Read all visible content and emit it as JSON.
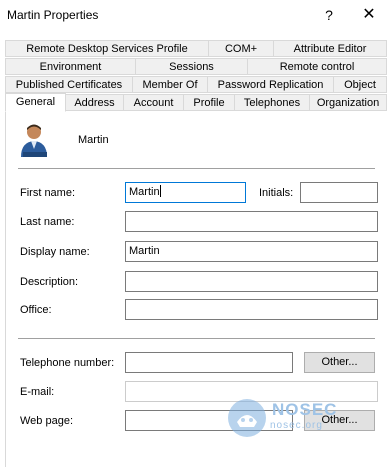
{
  "window": {
    "title": "Martin Properties",
    "help_glyph": "?",
    "close_glyph": "✕"
  },
  "tabs": {
    "row1": [
      "Remote Desktop Services Profile",
      "COM+",
      "Attribute Editor"
    ],
    "row2": [
      "Environment",
      "Sessions",
      "Remote control"
    ],
    "row3": [
      "Published Certificates",
      "Member Of",
      "Password Replication",
      "Object"
    ],
    "row4": [
      "General",
      "Address",
      "Account",
      "Profile",
      "Telephones",
      "Organization"
    ],
    "active": "General"
  },
  "general": {
    "user_display": "Martin",
    "first_name_label": "First name:",
    "first_name_value": "Martin",
    "initials_label": "Initials:",
    "initials_value": "",
    "last_name_label": "Last name:",
    "last_name_value": "",
    "display_name_label": "Display name:",
    "display_name_value": "Martin",
    "description_label": "Description:",
    "description_value": "",
    "office_label": "Office:",
    "office_value": "",
    "telephone_label": "Telephone number:",
    "telephone_value": "",
    "telephone_other_button": "Other...",
    "email_label": "E-mail:",
    "email_value": "",
    "webpage_label": "Web page:",
    "webpage_value": "",
    "webpage_other_button": "Other..."
  },
  "watermark": {
    "line1": "NOSEC",
    "line2": "nosec.org"
  }
}
